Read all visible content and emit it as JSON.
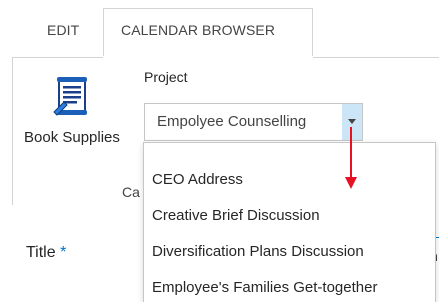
{
  "tabs": [
    {
      "label": "EDIT",
      "active": false
    },
    {
      "label": "CALENDAR BROWSER",
      "active": true
    }
  ],
  "ribbon": {
    "book_supplies_label": "Book Supplies",
    "book_supplies_icon": "book-scroll-icon",
    "project_label": "Project",
    "project_selected": "Empolyee Counselling",
    "group_label_partial": "Ca"
  },
  "dropdown": {
    "options": [
      "CEO Address",
      "Creative Brief Discussion",
      "Diversification Plans Discussion",
      "Employee's Families Get-together"
    ]
  },
  "form": {
    "title_label": "Title",
    "required_marker": "*",
    "field_edge_char": "n"
  },
  "colors": {
    "accent": "#0072c6",
    "annotation_arrow": "#e81123",
    "dropdown_button": "#cde6f7"
  }
}
